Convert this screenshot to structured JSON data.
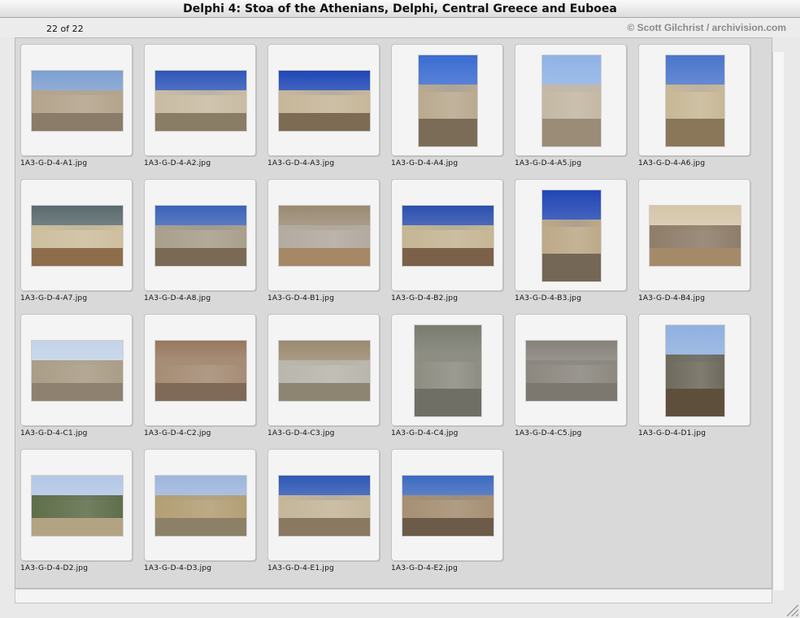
{
  "window": {
    "title": "Delphi 4: Stoa of the Athenians, Delphi, Central Greece and Euboea"
  },
  "header": {
    "count": "22 of 22",
    "copyright": "© Scott Gilchrist / archivision.com"
  },
  "thumbnails": [
    {
      "filename": "1A3-G-D-4-A1.jpg",
      "orientation": "land",
      "sky": "#7d9fd0",
      "wall": "#b4a48c",
      "ground": "#8a7c68"
    },
    {
      "filename": "1A3-G-D-4-A2.jpg",
      "orientation": "land",
      "sky": "#2f56b8",
      "wall": "#c9bca3",
      "ground": "#8a7d66"
    },
    {
      "filename": "1A3-G-D-4-A3.jpg",
      "orientation": "land",
      "sky": "#1f47b5",
      "wall": "#c7b79a",
      "ground": "#7d6c53"
    },
    {
      "filename": "1A3-G-D-4-A4.jpg",
      "orientation": "port",
      "sky": "#3a6cd1",
      "wall": "#b9a98f",
      "ground": "#7b6c58"
    },
    {
      "filename": "1A3-G-D-4-A5.jpg",
      "orientation": "port",
      "sky": "#8fb2e6",
      "wall": "#c4b8a4",
      "ground": "#9a8c76"
    },
    {
      "filename": "1A3-G-D-4-A6.jpg",
      "orientation": "port",
      "sky": "#4b75cc",
      "wall": "#c8b896",
      "ground": "#8a7659"
    },
    {
      "filename": "1A3-G-D-4-A7.jpg",
      "orientation": "land",
      "sky": "#5a6a6e",
      "wall": "#cdbf9e",
      "ground": "#8d6d4c"
    },
    {
      "filename": "1A3-G-D-4-A8.jpg",
      "orientation": "land",
      "sky": "#3c63b8",
      "wall": "#a99f8c",
      "ground": "#7a6a55"
    },
    {
      "filename": "1A3-G-D-4-B1.jpg",
      "orientation": "land",
      "sky": "#9a8a72",
      "wall": "#b3aaa0",
      "ground": "#a68866"
    },
    {
      "filename": "1A3-G-D-4-B2.jpg",
      "orientation": "land",
      "sky": "#2b4fae",
      "wall": "#c5b694",
      "ground": "#7a6148"
    },
    {
      "filename": "1A3-G-D-4-B3.jpg",
      "orientation": "port",
      "sky": "#2247b5",
      "wall": "#bda988",
      "ground": "#746756"
    },
    {
      "filename": "1A3-G-D-4-B4.jpg",
      "orientation": "land",
      "sky": "#d5c6a8",
      "wall": "#8f7d6a",
      "ground": "#a58a6a"
    },
    {
      "filename": "1A3-G-D-4-C1.jpg",
      "orientation": "land",
      "sky": "#c3d3e8",
      "wall": "#aa9d86",
      "ground": "#8e8170"
    },
    {
      "filename": "1A3-G-D-4-C2.jpg",
      "orientation": "land",
      "sky": "#98785e",
      "wall": "#a68c74",
      "ground": "#7f6a58"
    },
    {
      "filename": "1A3-G-D-4-C3.jpg",
      "orientation": "land",
      "sky": "#9a8a70",
      "wall": "#b9b6ad",
      "ground": "#8d8572"
    },
    {
      "filename": "1A3-G-D-4-C4.jpg",
      "orientation": "tall",
      "sky": "#7a7b70",
      "wall": "#8e8d82",
      "ground": "#6f6f66"
    },
    {
      "filename": "1A3-G-D-4-C5.jpg",
      "orientation": "land",
      "sky": "#85817a",
      "wall": "#8c8880",
      "ground": "#7c7870"
    },
    {
      "filename": "1A3-G-D-4-D1.jpg",
      "orientation": "port",
      "sky": "#8fb0e0",
      "wall": "#6e6a5c",
      "ground": "#5e4f3d"
    },
    {
      "filename": "1A3-G-D-4-D2.jpg",
      "orientation": "land",
      "sky": "#b3c7e6",
      "wall": "#5f6e4a",
      "ground": "#b2a383"
    },
    {
      "filename": "1A3-G-D-4-D3.jpg",
      "orientation": "land",
      "sky": "#9eb6dd",
      "wall": "#b39f75",
      "ground": "#8d8068"
    },
    {
      "filename": "1A3-G-D-4-E1.jpg",
      "orientation": "land",
      "sky": "#2f58b5",
      "wall": "#c5b699",
      "ground": "#8a7860"
    },
    {
      "filename": "1A3-G-D-4-E2.jpg",
      "orientation": "land",
      "sky": "#3d6ac0",
      "wall": "#a68f73",
      "ground": "#6c5b48"
    }
  ]
}
